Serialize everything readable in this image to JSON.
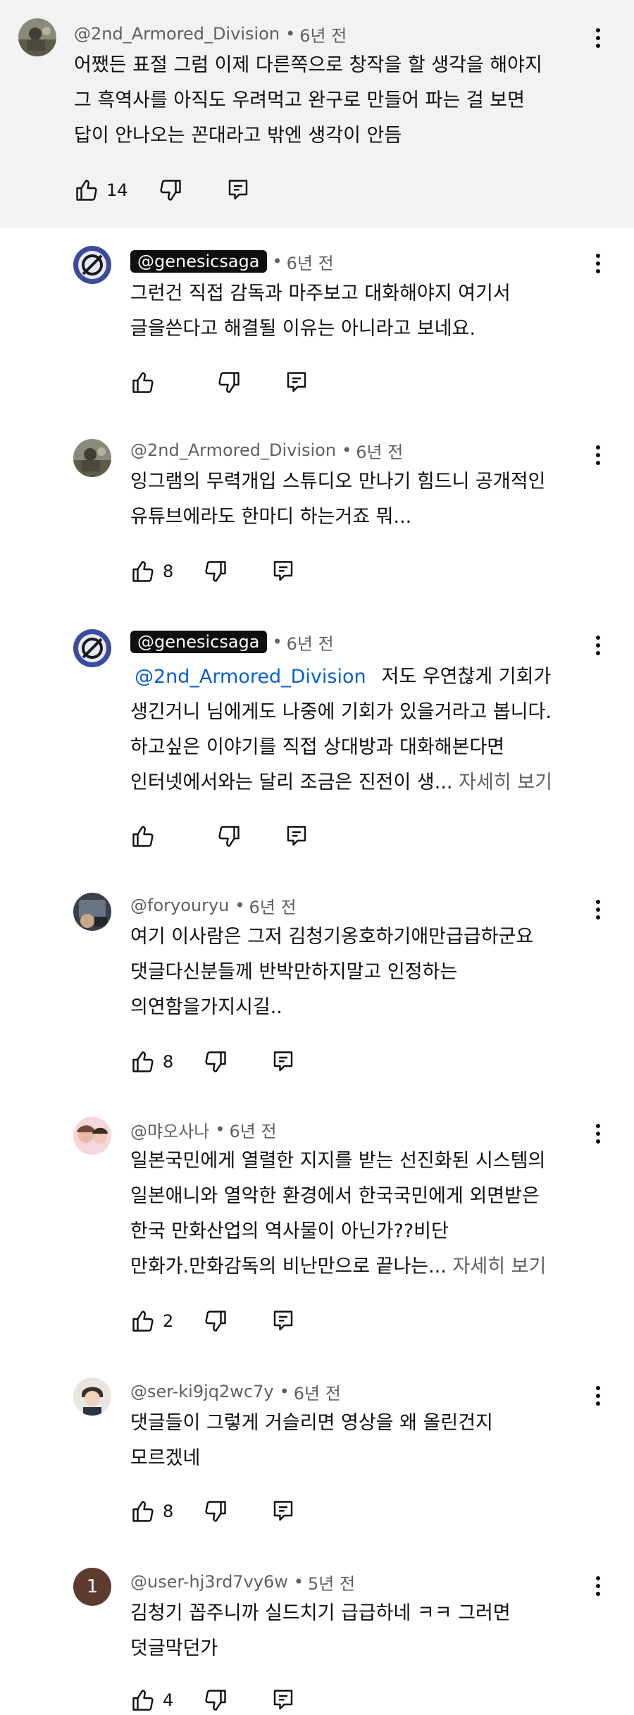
{
  "comments": [
    {
      "handle": "@2nd_Armored_Division",
      "time": "6년 전",
      "lines": [
        "어쨌든 표절 그럼 이제 다른쪽으로 창작을 할 생각을 해야지",
        "그 흑역사를 아직도 우려먹고 완구로 만들어 파는 걸 보면",
        "답이 안나오는 꼰대라고 밖엔 생각이 안듬"
      ],
      "likes": "14"
    },
    {
      "handle": "@genesicsaga",
      "time": "6년 전",
      "lines": [
        "그런건 직접 감독과 마주보고 대화해야지 여기서",
        "글을쓴다고 해결될 이유는 아니라고 보네요."
      ],
      "likes": ""
    },
    {
      "handle": "@2nd_Armored_Division",
      "time": "6년 전",
      "lines": [
        "잉그램의 무력개입 스튜디오 만나기 힘드니 공개적인",
        "유튜브에라도 한마디 하는거죠 뭐..."
      ],
      "likes": "8"
    },
    {
      "handle": "@genesicsaga",
      "time": "6년 전",
      "mention": "@2nd_Armored_Division",
      "line1_rest": "저도 우연찮게 기회가",
      "lines": [
        "생긴거니 님에게도 나중에 기회가 있을거라고 봅니다.",
        "하고싶은 이야기를 직접 상대방과 대화해본다면"
      ],
      "last_line": "인터넷에서와는 달리 조금은 진전이 생...",
      "read_more": "자세히 보기",
      "likes": ""
    },
    {
      "handle": "@foryouryu",
      "time": "6년 전",
      "lines": [
        "여기 이사람은 그저 김청기옹호하기애만급급하군요",
        "댓글다신분들께 반박만하지말고 인정하는",
        "의연함을가지시길.."
      ],
      "likes": "8"
    },
    {
      "handle": "@먀오사나",
      "time": "6년 전",
      "lines": [
        "일본국민에게 열렬한 지지를 받는 선진화된 시스템의",
        "일본애니와  열악한  환경에서  한국국민에게 외면받은",
        "한국 만화산업의  역사물이 아닌가??비단"
      ],
      "last_line": "만화가.만화감독의 비난만으로 끝나는...",
      "read_more": "자세히 보기",
      "likes": "2"
    },
    {
      "handle": "@ser-ki9jq2wc7y",
      "time": "6년 전",
      "lines": [
        "댓글들이 그렇게 거슬리면 영상을 왜 올린건지",
        "모르겠네"
      ],
      "likes": "8"
    },
    {
      "handle": "@user-hj3rd7vy6w",
      "time": "5년 전",
      "avatar_letter": "1",
      "lines": [
        "김청기 꼽주니까 실드치기 급급하네 ㅋㅋ 그러면",
        "덧글막던가"
      ],
      "likes": "4"
    }
  ],
  "separator": "•",
  "icons": {
    "like": "thumb-up-icon",
    "dislike": "thumb-down-icon",
    "reply": "reply-icon",
    "menu": "more-vert-icon"
  }
}
